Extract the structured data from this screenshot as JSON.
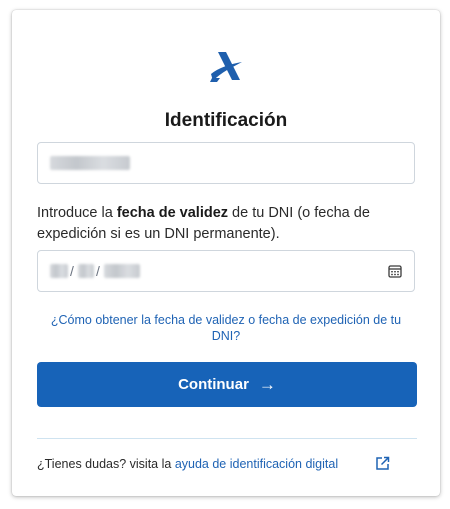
{
  "title": "Identificación",
  "instructions": {
    "before": "Introduce la ",
    "emphasis": "fecha de validez",
    "after": " de tu DNI (o fecha de expedición si es un DNI permanente)."
  },
  "date_field": {
    "separator": "/"
  },
  "help_link": "¿Cómo obtener la fecha de validez o fecha de expedición de tu DNI?",
  "continue_button": {
    "label": "Continuar",
    "arrow": "→"
  },
  "footer": {
    "text": "¿Tienes dudas? visita la ",
    "link": "ayuda de identificación digital"
  },
  "icons": {
    "logo": "agencia-tributaria-logo",
    "calendar": "calendar-icon",
    "external": "external-link-icon"
  },
  "colors": {
    "primary": "#1763b8",
    "link": "#1f63b4",
    "logo": "#1f5fad"
  }
}
